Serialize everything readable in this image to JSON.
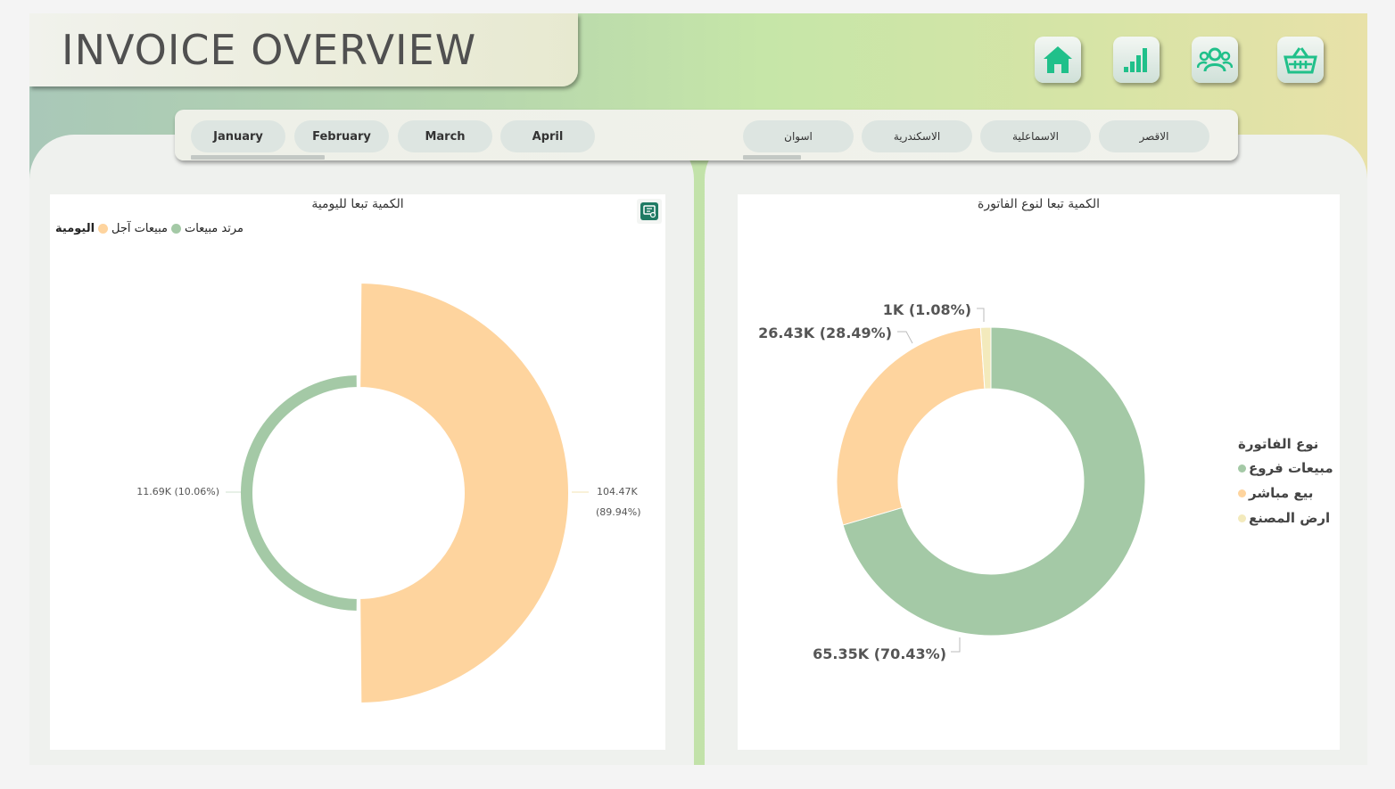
{
  "header": {
    "title": "INVOICE OVERVIEW"
  },
  "nav": [
    {
      "name": "home-button",
      "icon": "home-icon"
    },
    {
      "name": "analytics-button",
      "icon": "bar-chart-icon"
    },
    {
      "name": "customers-button",
      "icon": "users-icon"
    },
    {
      "name": "products-button",
      "icon": "basket-icon"
    }
  ],
  "month_slicer": [
    "January",
    "February",
    "March",
    "April"
  ],
  "branch_slicer": [
    "اسوان",
    "الاسكندرية",
    "الاسماعلية",
    "الاقصر"
  ],
  "colors": {
    "green": "#a4c9a6",
    "orange": "#fed49e",
    "cream": "#f3eabc",
    "accent": "#1f7a63"
  },
  "left_chart": {
    "title": "الكمية تبعا لليومية",
    "legend_title": "اليومية",
    "legend_items": [
      {
        "label": "مبيعات آجل",
        "color": "#fed49e"
      },
      {
        "label": "مرتد مبيعات",
        "color": "#a4c9a6"
      }
    ],
    "label_big_value": "104.47K",
    "label_big_pct": "(89.94%)",
    "label_small": "11.69K (10.06%)"
  },
  "right_chart": {
    "title": "الكمية تبعا لنوع الفاتورة",
    "legend_title": "نوع الفاتورة",
    "legend_items": [
      {
        "label": "مبيعات فروع",
        "color": "#a4c9a6"
      },
      {
        "label": "بيع مباشر",
        "color": "#fed49e"
      },
      {
        "label": "ارض المصنع",
        "color": "#f3eabc"
      }
    ],
    "label_1": "65.35K (70.43%)",
    "label_2": "26.43K (28.49%)",
    "label_3": "1K (1.08%)"
  },
  "chart_data": [
    {
      "type": "pie",
      "title": "الكمية تبعا لليومية",
      "legend_title": "اليومية",
      "categories": [
        "مبيعات آجل",
        "مرتد مبيعات"
      ],
      "values": [
        104470,
        11690
      ],
      "percentages": [
        89.94,
        10.06
      ],
      "legend": "top-left"
    },
    {
      "type": "pie",
      "title": "الكمية تبعا لنوع الفاتورة",
      "legend_title": "نوع الفاتورة",
      "categories": [
        "مبيعات فروع",
        "بيع مباشر",
        "ارض المصنع"
      ],
      "values": [
        65350,
        26430,
        1000
      ],
      "percentages": [
        70.43,
        28.49,
        1.08
      ],
      "legend": "right"
    }
  ]
}
